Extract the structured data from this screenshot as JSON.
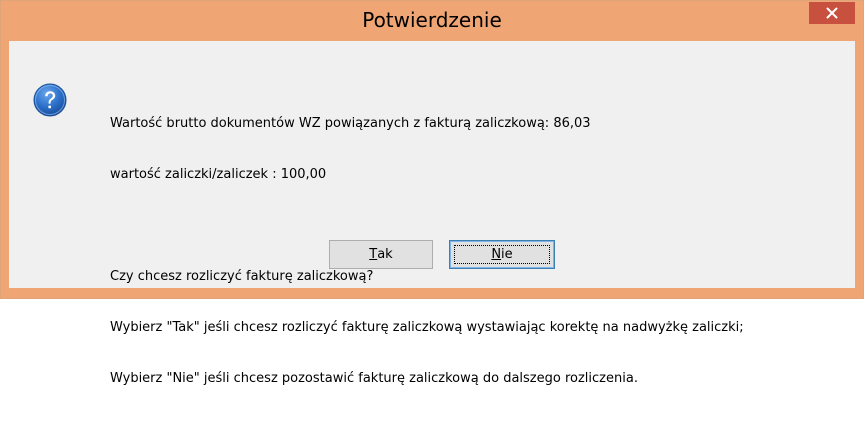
{
  "dialog": {
    "title": "Potwierdzenie",
    "close_icon": "close-icon",
    "question_icon": "question-icon"
  },
  "message": {
    "line1": "Wartość brutto dokumentów WZ powiązanych z fakturą zaliczkową: 86,03",
    "line2": "wartość zaliczki/zaliczek : 100,00",
    "line3": "Czy chcesz rozliczyć fakturę zaliczkową?",
    "line4": "Wybierz \"Tak\" jeśli chcesz rozliczyć fakturę zaliczkową wystawiając korektę na nadwyżkę zaliczki;",
    "line5": "Wybierz \"Nie\" jeśli chcesz pozostawić fakturę zaliczkową do dalszego rozliczenia."
  },
  "buttons": {
    "yes_first": "T",
    "yes_rest": "ak",
    "no_first": "N",
    "no_rest": "ie"
  },
  "colors": {
    "titlebar": "#f0a674",
    "close": "#c7503f",
    "client": "#f0f0f0",
    "icon": "#2a6fc9"
  }
}
